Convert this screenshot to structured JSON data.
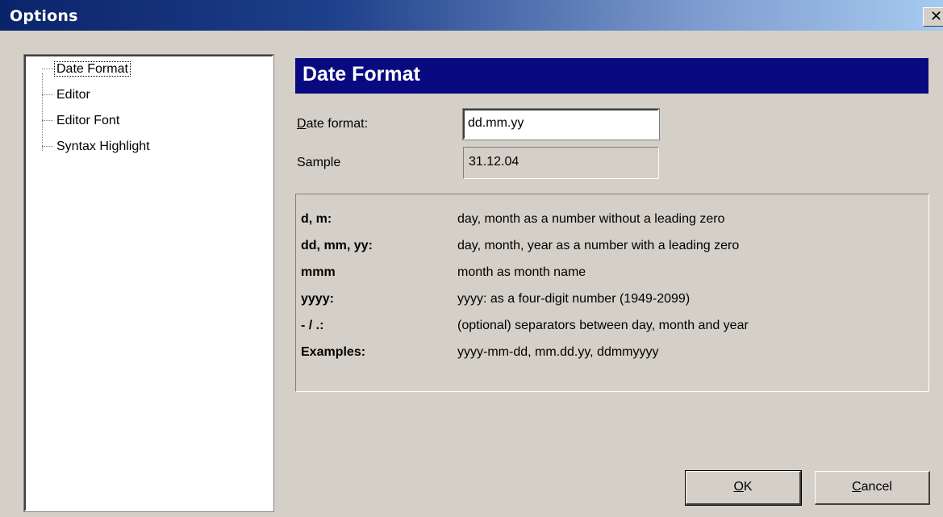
{
  "window": {
    "title": "Options",
    "close_glyph": "✕"
  },
  "tree": {
    "items": [
      {
        "label": "Date Format",
        "selected": true
      },
      {
        "label": "Editor"
      },
      {
        "label": "Editor Font"
      },
      {
        "label": "Syntax Highlight"
      }
    ]
  },
  "panel": {
    "header": "Date Format",
    "date_format_label_mnemonic": "D",
    "date_format_label_rest": "ate format:",
    "date_format_value": "dd.mm.yy",
    "sample_label": "Sample",
    "sample_value": "31.12.04"
  },
  "help": {
    "rows": [
      {
        "key": "d, m:",
        "desc": "day, month as a number without a leading zero"
      },
      {
        "key": "dd, mm, yy:",
        "desc": "day, month, year as a number with a leading zero"
      },
      {
        "key": "mmm",
        "desc": "month as month name"
      },
      {
        "key": "yyyy:",
        "desc": "yyyy: as a four-digit number (1949-2099)"
      },
      {
        "key": "- / .:",
        "desc": "(optional) separators between day, month and year"
      },
      {
        "key": "Examples:",
        "desc": "yyyy-mm-dd, mm.dd.yy, ddmmyyyy"
      }
    ]
  },
  "buttons": {
    "ok_mnemonic": "O",
    "ok_rest": "K",
    "cancel_mnemonic": "C",
    "cancel_rest": "ancel"
  },
  "colors": {
    "titlebar_start": "#0a246a",
    "titlebar_end": "#a6caf0",
    "header_bg": "#0a0a80",
    "dialog_bg": "#d4d0c8"
  }
}
